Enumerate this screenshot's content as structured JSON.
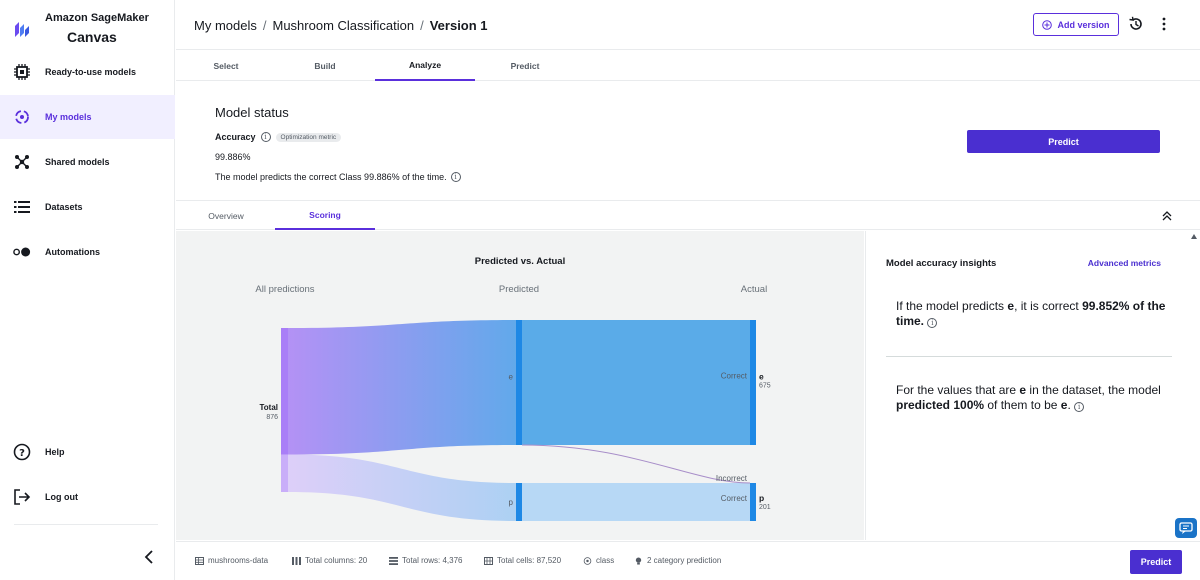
{
  "brand": {
    "line1": "Amazon SageMaker",
    "line2": "Canvas",
    "accent": "#5a2fdc"
  },
  "sidebar": {
    "items": [
      {
        "label": "Ready-to-use models",
        "icon": "chip-icon"
      },
      {
        "label": "My models",
        "icon": "target-icon",
        "active": true
      },
      {
        "label": "Shared models",
        "icon": "share-node-icon"
      },
      {
        "label": "Datasets",
        "icon": "list-icon"
      },
      {
        "label": "Automations",
        "icon": "toggle-icon"
      }
    ],
    "bottom": [
      {
        "label": "Help",
        "icon": "help-icon"
      },
      {
        "label": "Log out",
        "icon": "logout-icon"
      }
    ]
  },
  "header": {
    "breadcrumb": [
      "My models",
      "Mushroom Classification",
      "Version 1"
    ],
    "add_version": "Add version"
  },
  "steps": [
    "Select",
    "Build",
    "Analyze",
    "Predict"
  ],
  "active_step": "Analyze",
  "status": {
    "title": "Model status",
    "accuracy_label": "Accuracy",
    "badge": "Optimization metric",
    "accuracy_value": "99.886%",
    "description": "The model predicts the correct Class 99.886% of the time.",
    "predict_label": "Predict"
  },
  "subtabs": [
    "Overview",
    "Scoring"
  ],
  "active_subtab": "Scoring",
  "chart_data": {
    "type": "sankey",
    "title": "Predicted vs. Actual",
    "column_headers": [
      "All predictions",
      "Predicted",
      "Actual"
    ],
    "source": {
      "label": "Total",
      "value": 876
    },
    "predicted": [
      {
        "label": "e",
        "value": 676
      },
      {
        "label": "p",
        "value": 200
      }
    ],
    "actual": [
      {
        "label": "e",
        "value": 675,
        "status": "Correct"
      },
      {
        "label": "p",
        "value": 201,
        "status": "Correct"
      }
    ],
    "incorrect_label": "Incorrect",
    "flows": [
      {
        "from": "e",
        "to": "e",
        "value": 675
      },
      {
        "from": "e",
        "to": "p",
        "value": 1
      },
      {
        "from": "p",
        "to": "p",
        "value": 200
      }
    ],
    "colors": {
      "source_top": "#a78bfa",
      "e": "#1e88e5",
      "p": "#90c4f4",
      "link_e": "#5aabe8",
      "link_p": "#b7d8f5",
      "incorrect": "#a88ec9"
    }
  },
  "insights": {
    "title": "Model accuracy insights",
    "advanced": "Advanced metrics",
    "insight1": {
      "pre": "If the model predicts ",
      "cls": "e",
      "mid": ", it is correct ",
      "pct": "99.852% of the time."
    },
    "insight2": {
      "pre": "For the values that are ",
      "cls": "e",
      "mid": " in the dataset, the model ",
      "pct": "predicted 100%",
      "post": " of them to be ",
      "cls2": "e",
      "end": "."
    }
  },
  "footer": {
    "dataset": "mushrooms-data",
    "columns": "Total columns: 20",
    "rows": "Total rows: 4,376",
    "cells": "Total cells: 87,520",
    "target": "class",
    "problem": "2 category prediction",
    "predict_label": "Predict"
  }
}
